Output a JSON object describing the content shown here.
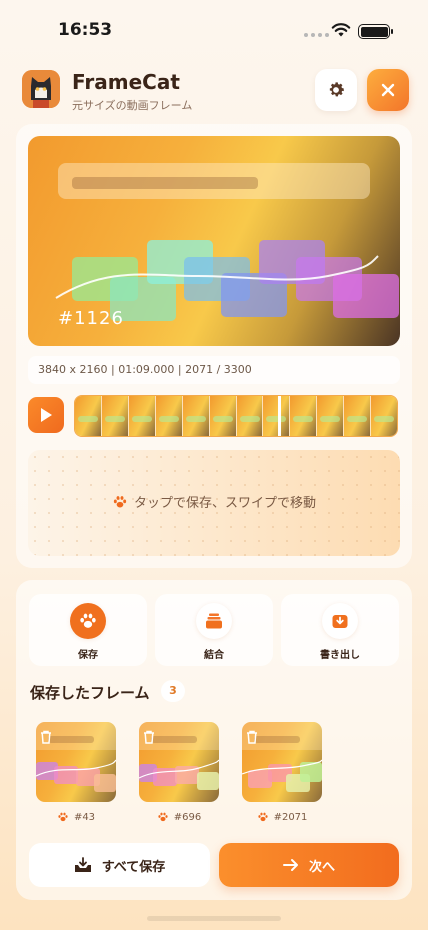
{
  "status": {
    "time": "16:53"
  },
  "header": {
    "title": "FrameCat",
    "subtitle": "元サイズの動画フレーム"
  },
  "preview": {
    "frame_label": "#1126"
  },
  "meta": {
    "info": "3840 x 2160  |  01:09.000  |  2071 / 3300"
  },
  "tapzone": {
    "message": "タップで保存、スワイプで移動"
  },
  "actions": [
    {
      "label": "保存",
      "icon": "paw-icon"
    },
    {
      "label": "結合",
      "icon": "stack-icon"
    },
    {
      "label": "書き出し",
      "icon": "download-icon"
    }
  ],
  "saved": {
    "title": "保存したフレーム",
    "count": "3",
    "items": [
      {
        "label": "#43"
      },
      {
        "label": "#696"
      },
      {
        "label": "#2071"
      }
    ]
  },
  "buttons": {
    "save_all": "すべて保存",
    "next": "次へ"
  },
  "colors": {
    "accent": "#f0701e",
    "accent_light": "#fdae3e",
    "text": "#3a2418"
  }
}
